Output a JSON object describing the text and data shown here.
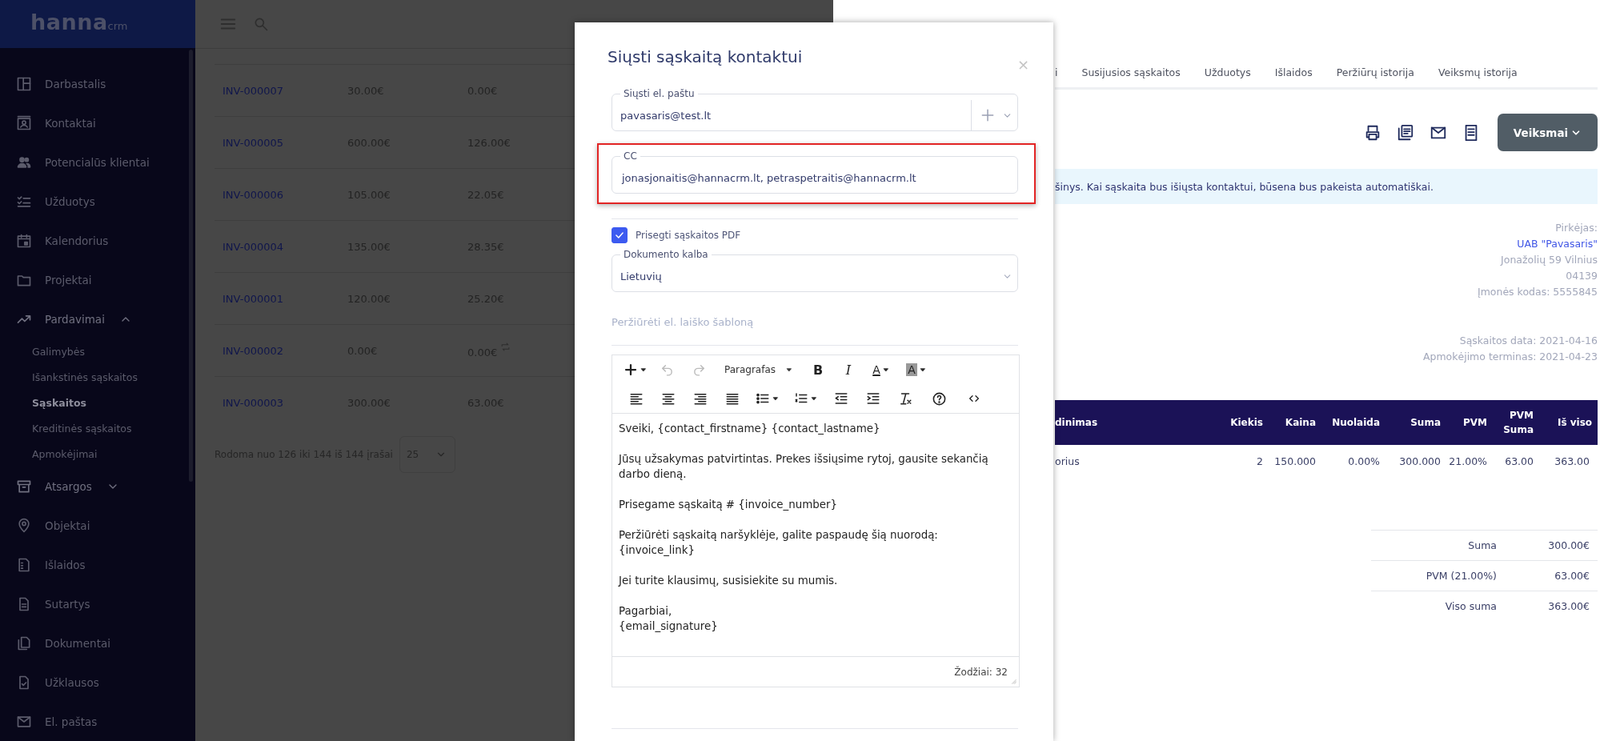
{
  "sidebar": {
    "logo": "hanna",
    "logo_suffix": "crm",
    "items": [
      {
        "label": "Darbastalis"
      },
      {
        "label": "Kontaktai"
      },
      {
        "label": "Potencialūs klientai"
      },
      {
        "label": "Užduotys"
      },
      {
        "label": "Kalendorius"
      },
      {
        "label": "Projektai"
      },
      {
        "label": "Pardavimai",
        "expanded": true,
        "children": [
          {
            "label": "Galimybės",
            "selected": false
          },
          {
            "label": "Išankstinės sąskaitos",
            "selected": false
          },
          {
            "label": "Sąskaitos",
            "selected": true
          },
          {
            "label": "Kreditinės sąskaitos",
            "selected": false
          },
          {
            "label": "Apmokėjimai",
            "selected": false
          }
        ]
      },
      {
        "label": "Atsargos",
        "expanded": false
      },
      {
        "label": "Objektai"
      },
      {
        "label": "Išlaidos"
      },
      {
        "label": "Sutartys"
      },
      {
        "label": "Dokumentai"
      },
      {
        "label": "Užklausos"
      },
      {
        "label": "El. paštas"
      }
    ]
  },
  "list": {
    "rows": [
      {
        "number": "INV-000007",
        "amount": "30.00€",
        "vat": "0.00€",
        "recurring": false
      },
      {
        "number": "INV-000005",
        "amount": "600.00€",
        "vat": "126.00€",
        "recurring": false
      },
      {
        "number": "INV-000006",
        "amount": "105.00€",
        "vat": "22.05€",
        "recurring": false
      },
      {
        "number": "INV-000004",
        "amount": "135.00€",
        "vat": "28.35€",
        "recurring": false
      },
      {
        "number": "INV-000001",
        "amount": "120.00€",
        "vat": "25.20€",
        "recurring": false
      },
      {
        "number": "INV-000002",
        "amount": "0.00€",
        "vat": "0.00€",
        "recurring": true
      },
      {
        "number": "INV-000003",
        "amount": "300.00€",
        "vat": "63.00€",
        "recurring": false
      }
    ],
    "pagination": {
      "summary": "Rodoma nuo 126 iki 144 iš 144 įrašai",
      "page_size": "25"
    }
  },
  "panel": {
    "tabs": [
      {
        "label": "i"
      },
      {
        "label": "Susijusios sąskaitos"
      },
      {
        "label": "Užduotys"
      },
      {
        "label": "Išlaidos"
      },
      {
        "label": "Peržiūrų istorija"
      },
      {
        "label": "Veiksmų istorija"
      }
    ],
    "actions_button": "Veiksmai",
    "notice": "šinys. Kai sąskaita bus išiųsta kontaktui, būsena bus pakeista automatiškai.",
    "buyer": {
      "heading": "Pirkėjas:",
      "name": "UAB \"Pavasaris\"",
      "address": "Jonažolių 59 Vilnius",
      "postcode": "04139",
      "company_code": "Įmonės kodas: 5555845"
    },
    "dates": [
      "Sąskaitos data: 2021-04-16",
      "Apmokėjimo terminas: 2021-04-23"
    ],
    "table": {
      "columns": [
        "dinimas",
        "Kiekis",
        "Kaina",
        "Nuolaida",
        "Suma",
        "PVM",
        "PVM Suma",
        "Iš viso"
      ],
      "rows": [
        [
          "orius",
          "2",
          "150.000",
          "0.00%",
          "300.000",
          "21.00%",
          "63.00",
          "363.00"
        ]
      ]
    },
    "totals": [
      {
        "label": "Suma",
        "value": "300.00€"
      },
      {
        "label": "PVM (21.00%)",
        "value": "63.00€"
      },
      {
        "label": "Viso suma",
        "value": "363.00€"
      }
    ]
  },
  "modal": {
    "title": "Siųsti sąskaitą kontaktui",
    "close": "×",
    "to": {
      "legend": "Siųsti el. paštu",
      "value": "pavasaris@test.lt"
    },
    "cc": {
      "legend": "CC",
      "value": "jonasjonaitis@hannacrm.lt, petraspetraitis@hannacrm.lt",
      "highlighted": true
    },
    "attach_pdf": {
      "label": "Prisegti sąskaitos PDF",
      "checked": true
    },
    "language": {
      "legend": "Dokumento kalba",
      "value": "Lietuvių"
    },
    "template_link": "Peržiūrėti el. laiško šabloną",
    "editor": {
      "format": "Paragrafas",
      "bold": "B",
      "italic": "I",
      "text_color": "A",
      "highlight": "A",
      "paragraphs": [
        "Sveiki, {contact_firstname} {contact_lastname}",
        "Jūsų užsakymas patvirtintas. Prekes išsiųsime rytoj, gausite sekančią darbo dieną.",
        "Prisegame sąskaitą # {invoice_number}",
        "Peržiūrėti sąskaitą naršyklėje, galite paspaudę šią nuorodą: {invoice_link}",
        "Jei turite klausimų, susisiekite su mumis.",
        "Pagarbiai,\n{email_signature}"
      ],
      "word_count": "Žodžiai: 32"
    }
  }
}
